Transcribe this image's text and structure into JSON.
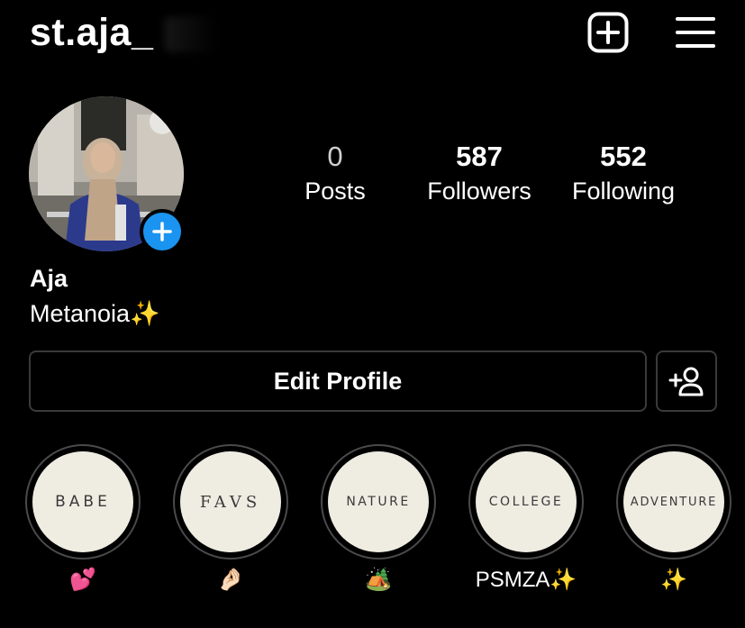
{
  "header": {
    "username": "st.aja_",
    "new_post_icon": "plus-square-icon",
    "menu_icon": "hamburger-menu-icon"
  },
  "profile": {
    "avatar_icon": "profile-photo",
    "add_story_icon": "plus-circle-icon",
    "display_name": "Aja",
    "bio": "Metanoia✨"
  },
  "stats": {
    "posts": {
      "count": "0",
      "label": "Posts"
    },
    "followers": {
      "count": "587",
      "label": "Followers"
    },
    "following": {
      "count": "552",
      "label": "Following"
    }
  },
  "actions": {
    "edit_profile_label": "Edit Profile",
    "add_friend_icon": "add-person-icon"
  },
  "highlights": [
    {
      "cover_text": "BABE",
      "label": "💕"
    },
    {
      "cover_text": "FAVS",
      "label": "🤌🏻"
    },
    {
      "cover_text": "NATURE",
      "label": "🏕️"
    },
    {
      "cover_text": "COLLEGE",
      "label": "PSMZA✨"
    },
    {
      "cover_text": "ADVENTURE",
      "label": "✨"
    }
  ],
  "colors": {
    "background": "#000000",
    "text": "#ffffff",
    "accent_blue": "#1a94f0",
    "highlight_cover": "#efece2",
    "border": "#3a3a3a"
  }
}
